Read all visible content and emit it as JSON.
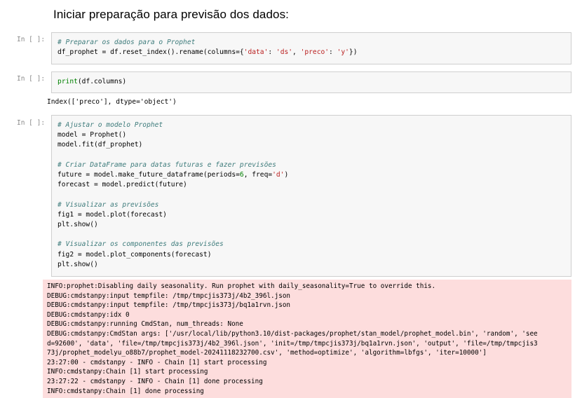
{
  "heading": "Iniciar preparação para previsão dos dados:",
  "cells": [
    {
      "prompt": "In [ ]:",
      "lines": [
        [
          {
            "t": "# Preparar os dados para o Prophet",
            "c": "cm"
          }
        ],
        [
          {
            "t": "df_prophet = df.reset_index().rename(columns={"
          },
          {
            "t": "'data'",
            "c": "st"
          },
          {
            "t": ": "
          },
          {
            "t": "'ds'",
            "c": "st"
          },
          {
            "t": ", "
          },
          {
            "t": "'preco'",
            "c": "st"
          },
          {
            "t": ": "
          },
          {
            "t": "'y'",
            "c": "st"
          },
          {
            "t": "})"
          }
        ]
      ]
    },
    {
      "prompt": "In [ ]:",
      "lines": [
        [
          {
            "t": "print",
            "c": "nb"
          },
          {
            "t": "(df.columns)"
          }
        ]
      ],
      "output": "Index(['preco'], dtype='object')"
    },
    {
      "prompt": "In [ ]:",
      "lines": [
        [
          {
            "t": "# Ajustar o modelo Prophet",
            "c": "cm"
          }
        ],
        [
          {
            "t": "model = Prophet()"
          }
        ],
        [
          {
            "t": "model.fit(df_prophet)"
          }
        ],
        [
          {
            "t": ""
          }
        ],
        [
          {
            "t": "# Criar DataFrame para datas futuras e fazer previsões",
            "c": "cm"
          }
        ],
        [
          {
            "t": "future = model.make_future_dataframe(periods="
          },
          {
            "t": "6",
            "c": "num"
          },
          {
            "t": ", freq="
          },
          {
            "t": "'d'",
            "c": "st"
          },
          {
            "t": ")"
          }
        ],
        [
          {
            "t": "forecast = model.predict(future)"
          }
        ],
        [
          {
            "t": ""
          }
        ],
        [
          {
            "t": "# Visualizar as previsões",
            "c": "cm"
          }
        ],
        [
          {
            "t": "fig1 = model.plot(forecast)"
          }
        ],
        [
          {
            "t": "plt.show()"
          }
        ],
        [
          {
            "t": ""
          }
        ],
        [
          {
            "t": "# Visualizar os componentes das previsões",
            "c": "cm"
          }
        ],
        [
          {
            "t": "fig2 = model.plot_components(forecast)"
          }
        ],
        [
          {
            "t": "plt.show()"
          }
        ]
      ],
      "stderr": [
        "INFO:prophet:Disabling daily seasonality. Run prophet with daily_seasonality=True to override this.",
        "DEBUG:cmdstanpy:input tempfile: /tmp/tmpcjis373j/4b2_396l.json",
        "DEBUG:cmdstanpy:input tempfile: /tmp/tmpcjis373j/bq1a1rvn.json",
        "DEBUG:cmdstanpy:idx 0",
        "DEBUG:cmdstanpy:running CmdStan, num_threads: None",
        "DEBUG:cmdstanpy:CmdStan args: ['/usr/local/lib/python3.10/dist-packages/prophet/stan_model/prophet_model.bin', 'random', 'see",
        "d=92600', 'data', 'file=/tmp/tmpcjis373j/4b2_396l.json', 'init=/tmp/tmpcjis373j/bq1a1rvn.json', 'output', 'file=/tmp/tmpcjis3",
        "73j/prophet_modelyu_o88b7/prophet_model-20241118232700.csv', 'method=optimize', 'algorithm=lbfgs', 'iter=10000']",
        "23:27:00 - cmdstanpy - INFO - Chain [1] start processing",
        "INFO:cmdstanpy:Chain [1] start processing",
        "23:27:22 - cmdstanpy - INFO - Chain [1] done processing",
        "INFO:cmdstanpy:Chain [1] done processing"
      ]
    }
  ]
}
